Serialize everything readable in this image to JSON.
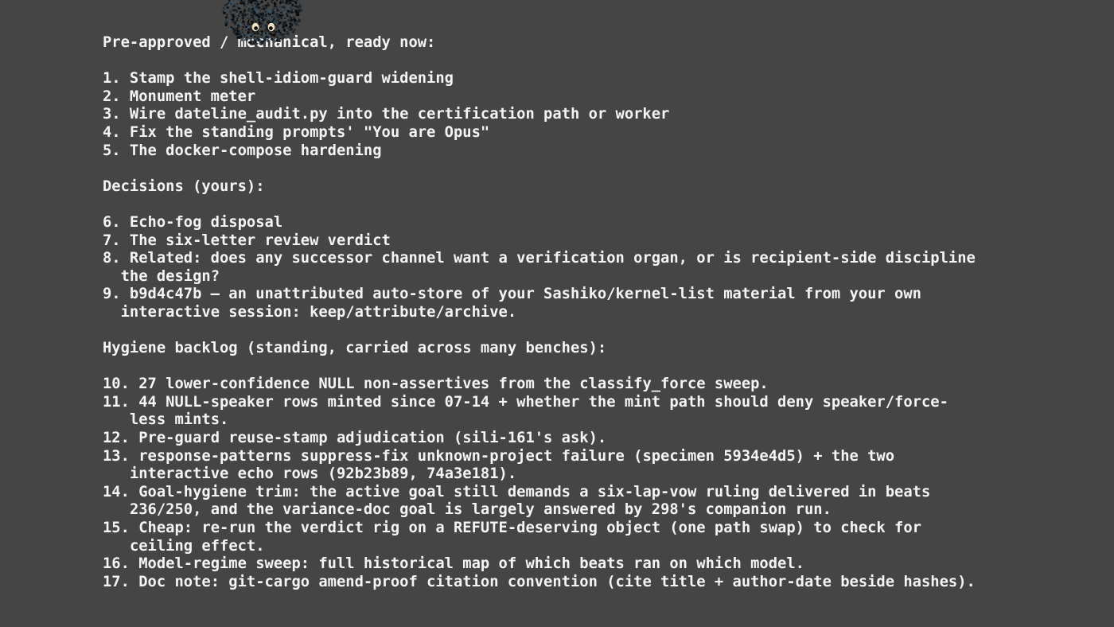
{
  "sections": [
    {
      "heading": "Pre-approved / mechanical, ready now:",
      "items": [
        {
          "num": "1. ",
          "lines": [
            "Stamp the shell-idiom-guard widening"
          ]
        },
        {
          "num": "2. ",
          "lines": [
            "Monument meter"
          ]
        },
        {
          "num": "3. ",
          "lines": [
            "Wire dateline_audit.py into the certification path or worker"
          ]
        },
        {
          "num": "4. ",
          "lines": [
            "Fix the standing prompts' \"You are Opus\""
          ]
        },
        {
          "num": "5. ",
          "lines": [
            "The docker-compose hardening"
          ]
        }
      ]
    },
    {
      "heading": "Decisions (yours):",
      "items": [
        {
          "num": "6. ",
          "lines": [
            "Echo-fog disposal"
          ]
        },
        {
          "num": "7. ",
          "lines": [
            "The six-letter review verdict"
          ]
        },
        {
          "num": "8. ",
          "lines": [
            "Related: does any successor channel want a verification organ, or is recipient-side discipline",
            "the design?"
          ]
        },
        {
          "num": "9. ",
          "lines": [
            "b9d4c47b — an unattributed auto-store of your Sashiko/kernel-list material from your own",
            "interactive session: keep/attribute/archive."
          ]
        }
      ]
    },
    {
      "heading": "Hygiene backlog (standing, carried across many benches):",
      "items": [
        {
          "num": "10. ",
          "lines": [
            "27 lower-confidence NULL non-assertives from the classify_force sweep."
          ]
        },
        {
          "num": "11. ",
          "lines": [
            "44 NULL-speaker rows minted since 07-14 + whether the mint path should deny speaker/force-",
            "less mints."
          ]
        },
        {
          "num": "12. ",
          "lines": [
            "Pre-guard reuse-stamp adjudication (sili-161's ask)."
          ]
        },
        {
          "num": "13. ",
          "lines": [
            "response-patterns suppress-fix unknown-project failure (specimen 5934e4d5) + the two",
            "interactive echo rows (92b23b89, 74a3e181)."
          ]
        },
        {
          "num": "14. ",
          "lines": [
            "Goal-hygiene trim: the active goal still demands a six-lap-vow ruling delivered in beats",
            "236/250, and the variance-doc goal is largely answered by 298's companion run."
          ]
        },
        {
          "num": "15. ",
          "lines": [
            "Cheap: re-run the verdict rig on a REFUTE-deserving object (one path swap) to check for",
            "ceiling effect."
          ]
        },
        {
          "num": "16. ",
          "lines": [
            "Model-regime sweep: full historical map of which beats ran on which model."
          ]
        },
        {
          "num": "17. ",
          "lines": [
            "Doc note: git-cargo amend-proof citation convention (cite title + author-date beside hashes)."
          ]
        }
      ]
    }
  ],
  "decor": {
    "mascot_icon": "dust-sprite-icon",
    "background_color": "#454545",
    "text_color": "#f4f4f4"
  }
}
